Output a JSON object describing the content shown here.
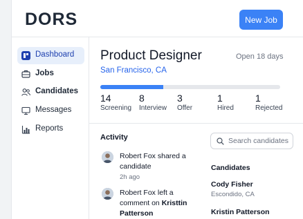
{
  "app": {
    "logo": "DORS",
    "new_job_label": "New Job"
  },
  "sidebar": {
    "items": [
      {
        "label": "Dashboard",
        "icon": "dashboard-icon",
        "active": true
      },
      {
        "label": "Jobs",
        "icon": "briefcase-icon"
      },
      {
        "label": "Candidates",
        "icon": "users-icon"
      },
      {
        "label": "Messages",
        "icon": "monitor-icon"
      },
      {
        "label": "Reports",
        "icon": "bar-chart-icon"
      }
    ]
  },
  "job": {
    "title": "Product Designer",
    "open_days": "Open 18 days",
    "location": "San Francisco, CA",
    "progress_fraction": 0.35,
    "stats": [
      {
        "value": "14",
        "label": "Screening"
      },
      {
        "value": "8",
        "label": "Interview"
      },
      {
        "value": "3",
        "label": "Offer"
      },
      {
        "value": "1",
        "label": "Hired"
      },
      {
        "value": "1",
        "label": "Rejected"
      }
    ]
  },
  "activity": {
    "title": "Activity",
    "items": [
      {
        "name": "Robert Fox",
        "action": "shared a candidate",
        "time": "2h ago"
      },
      {
        "name": "Robert Fox",
        "action": "left a comment on",
        "target": "Kristtin Patterson"
      }
    ]
  },
  "search": {
    "placeholder": "Search candidates"
  },
  "candidates": {
    "title": "Candidates",
    "items": [
      {
        "name": "Cody Fisher",
        "location": "Escondido, CA"
      },
      {
        "name": "Kristin Patterson",
        "location": ""
      }
    ]
  },
  "colors": {
    "accent": "#3b82f6",
    "active_bg": "#e7effb",
    "link": "#2563eb"
  }
}
